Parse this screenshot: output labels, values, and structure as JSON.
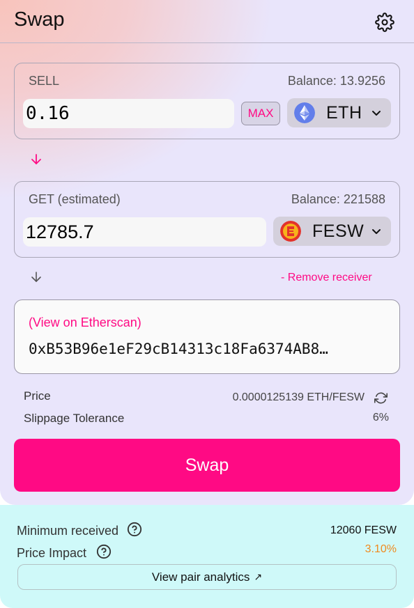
{
  "header": {
    "title": "Swap",
    "settings_icon": "gear-icon"
  },
  "sell": {
    "label": "SELL",
    "balance": "Balance: 13.9256",
    "amount": "0.16",
    "max_label": "MAX",
    "token": {
      "symbol": "ETH",
      "icon": "ethereum-icon"
    }
  },
  "get": {
    "label": "GET (estimated)",
    "balance": "Balance: 221588",
    "amount": "12785.7",
    "token": {
      "symbol": "FESW",
      "icon": "fesw-token-icon"
    }
  },
  "receiver": {
    "remove_label": "- Remove receiver",
    "etherscan_label": "(View on Etherscan)",
    "address": "0xB53B96e1eF29cB14313c18Fa6374AB8…"
  },
  "info": {
    "price_label": "Price",
    "price_value": "0.0000125139 ETH/FESW",
    "slippage_label": "Slippage Tolerance",
    "slippage_value": "6%"
  },
  "swap_button": "Swap",
  "details": {
    "min_received_label": "Minimum received",
    "min_received_value": "12060 FESW",
    "price_impact_label": "Price Impact",
    "price_impact_value": "3.10%",
    "analytics_label": "View pair analytics",
    "analytics_icon": "↗"
  },
  "colors": {
    "accent": "#ff0a84",
    "impact": "#f08a1e",
    "details_bg": "#cff9f9",
    "card_bg": "#e9e5fb"
  }
}
